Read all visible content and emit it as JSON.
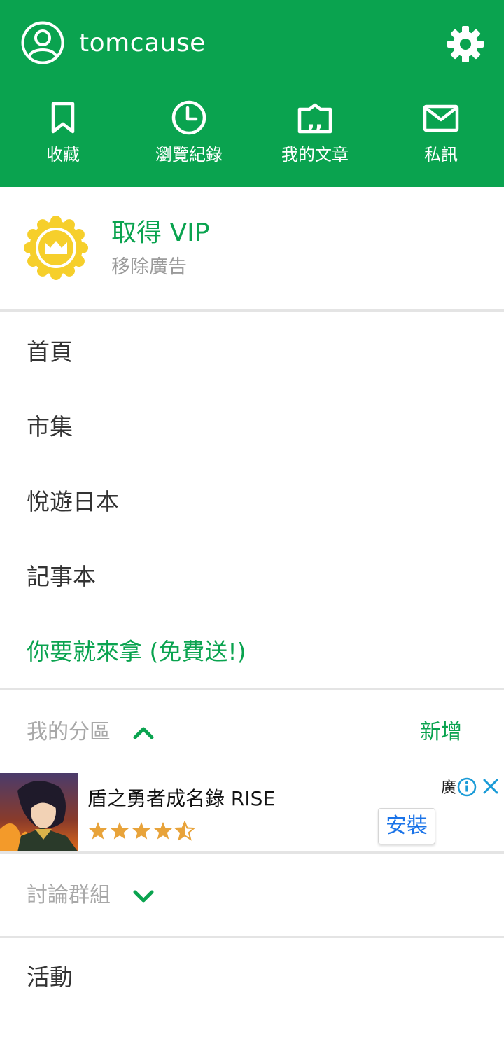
{
  "header": {
    "username": "tomcause",
    "quick_actions": [
      {
        "label": "收藏",
        "icon": "bookmark-icon"
      },
      {
        "label": "瀏覽紀錄",
        "icon": "clock-icon"
      },
      {
        "label": "我的文章",
        "icon": "article-quote-icon"
      },
      {
        "label": "私訊",
        "icon": "mail-icon"
      }
    ]
  },
  "vip": {
    "title": "取得 VIP",
    "subtitle": "移除廣告",
    "icon": "crown-badge-icon"
  },
  "menu": {
    "items": [
      "首頁",
      "市集",
      "悅遊日本",
      "記事本"
    ],
    "promo": "你要就來拿 (免費送!)"
  },
  "my_sections": {
    "title": "我的分區",
    "add_label": "新增",
    "expanded": true
  },
  "ad": {
    "title": "盾之勇者成名錄 RISE",
    "rating": 4.5,
    "tag": "廣",
    "install_label": "安裝"
  },
  "groups": {
    "title": "討論群組",
    "expanded": false
  },
  "events": {
    "label": "活動"
  },
  "colors": {
    "brand_green": "#0aa34f",
    "gold": "#f6cf2b",
    "star": "#e8a33a"
  }
}
